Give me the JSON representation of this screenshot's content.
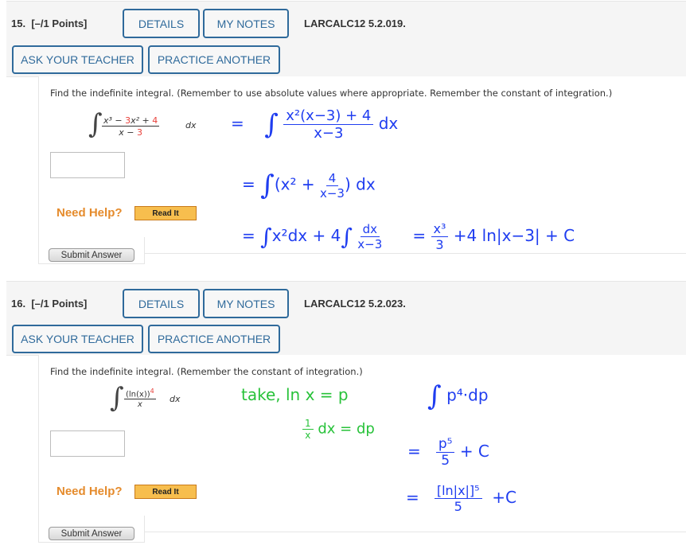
{
  "questions": [
    {
      "number": "15.",
      "points": "[–/1 Points]",
      "details_label": "DETAILS",
      "my_notes_label": "MY NOTES",
      "code": "LARCALC12 5.2.019.",
      "ask_teacher_label": "ASK YOUR TEACHER",
      "practice_label": "PRACTICE ANOTHER",
      "prompt": "Find the indefinite integral. (Remember to use absolute values where appropriate. Remember the constant of integration.)",
      "integrand": {
        "num_a": "x³ − ",
        "num_b": "3",
        "num_c": "x² + ",
        "num_d": "4",
        "den_a": "x − ",
        "den_b": "3",
        "dx": "dx"
      },
      "answer_value": "",
      "need_help_label": "Need Help?",
      "read_it_label": "Read It",
      "submit_label": "Submit Answer",
      "handwritten": {
        "line1_eq": "=",
        "line1_num": "x²(x−3) + 4",
        "line1_den": "x−3",
        "line1_dx": "dx",
        "line2_eq": "=",
        "line2_a": "(x² +",
        "line2_num": "4",
        "line2_den": "x−3",
        "line2_b": ") dx",
        "line3_eq": "=",
        "line3_a": "x²dx +  4",
        "line3_num": "dx",
        "line3_den": "x−3",
        "line3_eq2": "=",
        "line3_res_num": "x³",
        "line3_res_den": "3",
        "line3_res_tail": "+4 ln|x−3|  + C"
      }
    },
    {
      "number": "16.",
      "points": "[–/1 Points]",
      "details_label": "DETAILS",
      "my_notes_label": "MY NOTES",
      "code": "LARCALC12 5.2.023.",
      "ask_teacher_label": "ASK YOUR TEACHER",
      "practice_label": "PRACTICE ANOTHER",
      "prompt": "Find the indefinite integral. (Remember the constant of integration.)",
      "integrand": {
        "num_a": "(ln(x))",
        "num_b": "4",
        "den_a": "x",
        "dx": "dx"
      },
      "answer_value": "",
      "need_help_label": "Need Help?",
      "read_it_label": "Read It",
      "submit_label": "Submit Answer",
      "handwritten": {
        "green1": "take, ln x = p",
        "green2_num": "1",
        "green2_den": "x",
        "green2_tail": "dx = dp",
        "blue1": "p⁴·dp",
        "blue2_eq": "=",
        "blue2_num": "p⁵",
        "blue2_den": "5",
        "blue2_tail": "+ C",
        "blue3_eq": "=",
        "blue3_num": "[ln|x|]⁵",
        "blue3_den": "5",
        "blue3_tail": "+C"
      }
    }
  ],
  "colors": {
    "button_blue": "#2f6a9b",
    "highlight_red": "#e8403a",
    "need_help_orange": "#e58b2c",
    "read_it_bg": "#f7be4e",
    "ink_blue": "#1f3df0",
    "ink_green": "#28c23a"
  }
}
